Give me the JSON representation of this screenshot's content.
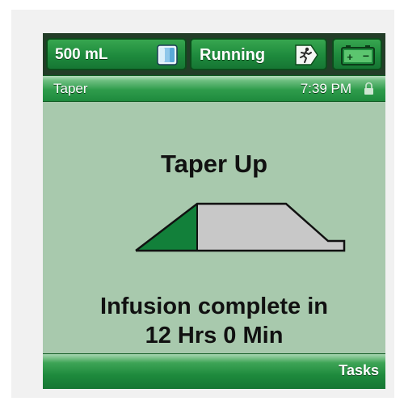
{
  "status_bar": {
    "volume_label": "500 mL",
    "volume_icon": "iv-bag-icon",
    "state_label": "Running",
    "state_icon": "running-person-icon",
    "battery_icon": "battery-icon"
  },
  "title_bar": {
    "title": "Taper",
    "time": "7:39 PM",
    "lock_icon": "lock-icon"
  },
  "main": {
    "heading": "Taper Up",
    "message_line1": "Infusion complete in",
    "message_line2": "12 Hrs 0 Min",
    "taper_graphic": {
      "shape": "trapezoid taper profile",
      "filled_fraction": 0.25
    }
  },
  "bottom_bar": {
    "tasks_label": "Tasks"
  },
  "colors": {
    "accent_green": "#1e8a3d",
    "screen_background": "#a8c9ad",
    "taper_fill": "#12803a",
    "taper_remaining": "#c8c8c8"
  }
}
